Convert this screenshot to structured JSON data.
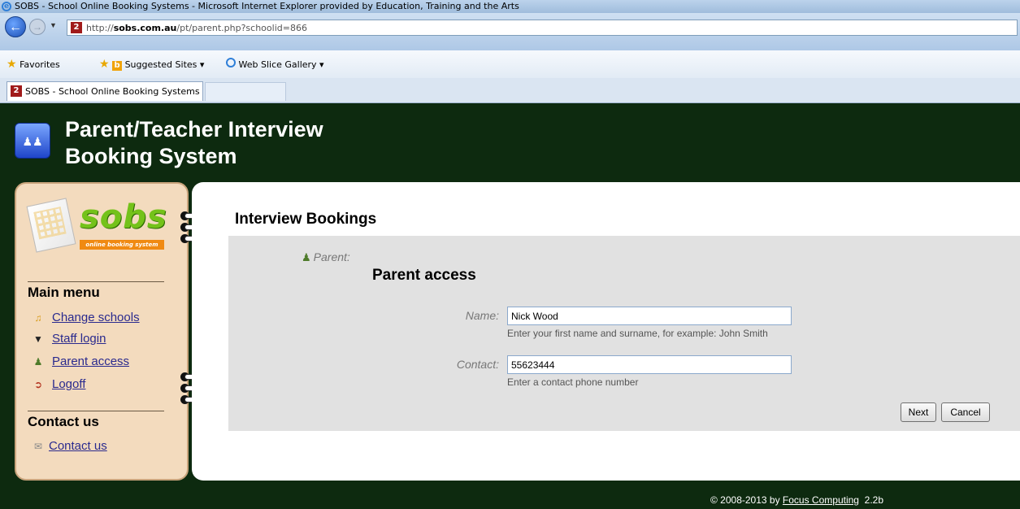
{
  "browser": {
    "window_title": "SOBS - School Online Booking Systems - Microsoft Internet Explorer provided by Education, Training and the Arts",
    "url_prefix": "http://",
    "url_domain": "sobs.com.au",
    "url_path": "/pt/parent.php?schoolid=866",
    "favorites_label": "Favorites",
    "suggested_sites_label": "Suggested Sites ▾",
    "web_slice_label": "Web Slice Gallery ▾",
    "tab_label": "SOBS - School Online Booking Systems",
    "site_icon_char": "2"
  },
  "header": {
    "title": "Parent/Teacher Interview Booking System"
  },
  "sidebar": {
    "logo_text": "sobs",
    "logo_tagline": "online booking system",
    "main_menu_heading": "Main menu",
    "menu_items": [
      {
        "label": "Change schools",
        "icon": "bell-icon"
      },
      {
        "label": "Staff login",
        "icon": "grad-cap-icon"
      },
      {
        "label": "Parent access",
        "icon": "parent-icon"
      },
      {
        "label": "Logoff",
        "icon": "logoff-icon"
      }
    ],
    "contact_heading": "Contact us",
    "contact_item": {
      "label": "Contact us",
      "icon": "envelope-icon"
    }
  },
  "main": {
    "title": "Interview Bookings",
    "parent_label": "Parent:",
    "panel_title": "Parent access",
    "name_label": "Name:",
    "name_value": "Nick Wood",
    "name_hint": "Enter your first name and surname, for example: John Smith",
    "contact_label": "Contact:",
    "contact_value": "55623444",
    "contact_hint": "Enter a contact phone number",
    "next_label": "Next",
    "cancel_label": "Cancel"
  },
  "footer": {
    "copyright": "© 2008-2013 by",
    "company": "Focus Computing",
    "version": "2.2b"
  },
  "colors": {
    "header_bg": "#0d2a0f",
    "sidebar_bg": "#f3dbbe",
    "panel_bg": "#e1e1e1",
    "link": "#2a2a8e",
    "logo_green": "#74c21a",
    "logo_orange": "#f08a12"
  }
}
